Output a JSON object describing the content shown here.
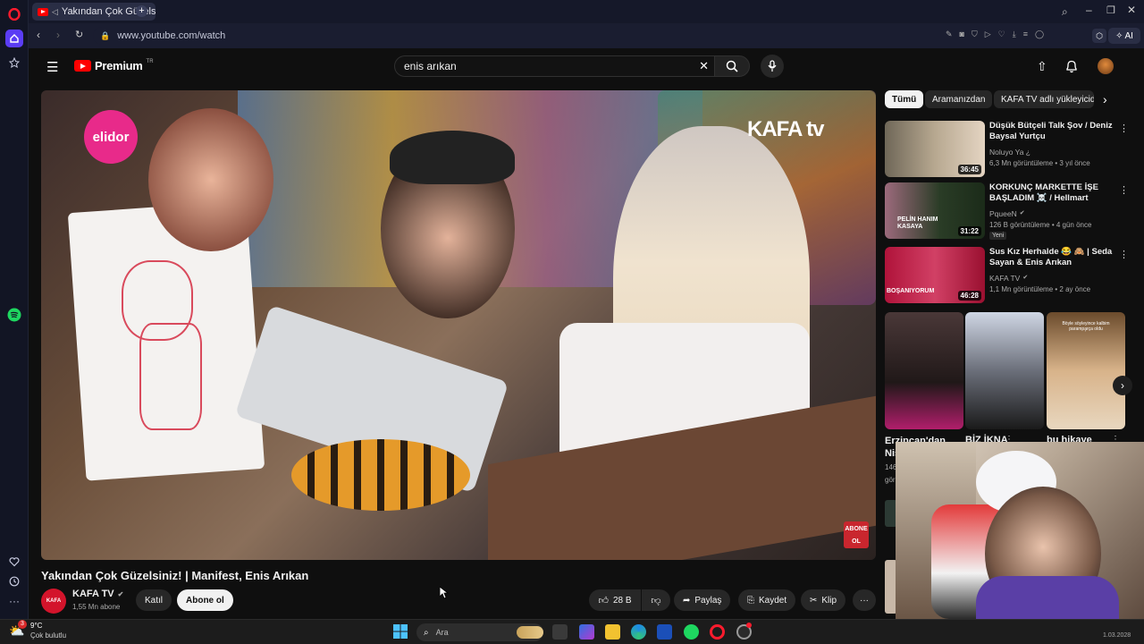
{
  "browser": {
    "tab_title": "Yakından Çok Güzelsin",
    "url": "www.youtube.com/watch",
    "ai_label": "AI"
  },
  "youtube": {
    "logo_text": "Premium",
    "logo_badge": "TR",
    "search_value": "enis arıkan",
    "video": {
      "title": "Yakından Çok Güzelsiniz! | Manifest, Enis Arıkan",
      "channel": "KAFA TV",
      "subscribers": "1,55 Mn abone",
      "join_label": "Katıl",
      "subscribe_label": "Abone ol",
      "likes": "28 B",
      "share_label": "Paylaş",
      "save_label": "Kaydet",
      "clip_label": "Klip",
      "overlay_elidor": "elidor",
      "overlay_kafatv": "KAFA tv",
      "overlay_abone": "ABONE OL"
    },
    "chips": [
      "Tümü",
      "Aramanızdan",
      "KAFA TV adlı yükleyiciden"
    ],
    "recommendations": [
      {
        "title": "Düşük Bütçeli Talk Şov / Deniz Baysal Yurtçu",
        "channel": "Noluyo Ya ¿",
        "meta": "6,3 Mn görüntüleme • 3 yıl önce",
        "duration": "36:45",
        "badge": ""
      },
      {
        "title": "KORKUNÇ MARKETTE İŞE BAŞLADIM ☠️ / Hellmart",
        "channel": "PqueeN",
        "meta": "126 B görüntüleme • 4 gün önce",
        "duration": "31:22",
        "badge": "Yeni",
        "thumb_text": "PELİN HANIM KASAYA"
      },
      {
        "title": "Sus Kız Herhalde 😂 🙈 | Seda Sayan & Enis Arıkan",
        "channel": "KAFA TV",
        "meta": "1,1 Mn görüntüleme • 2 ay önce",
        "duration": "46:28",
        "badge": "",
        "thumb_text": "BOŞANIYORUM"
      }
    ],
    "shorts": [
      {
        "title": "Erzincan'dan Nis",
        "meta1": "146",
        "meta2": "gör"
      },
      {
        "title": "BİZ İKNA",
        "meta1": "",
        "meta2": ""
      },
      {
        "title": "bu hikaye",
        "meta1": "",
        "meta2": "",
        "thumb_text": "Böyle söyleyince kalbim parampa̧rça oldu"
      }
    ]
  },
  "taskbar": {
    "weather_temp": "9°C",
    "weather_desc": "Çok bulutlu",
    "weather_badge": "3",
    "search_placeholder": "Ara",
    "date_fragment": "1.03.2028"
  },
  "colors": {
    "accent_red": "#ff0000",
    "opera_red": "#ff1b2d",
    "spotify_green": "#1ed760"
  }
}
